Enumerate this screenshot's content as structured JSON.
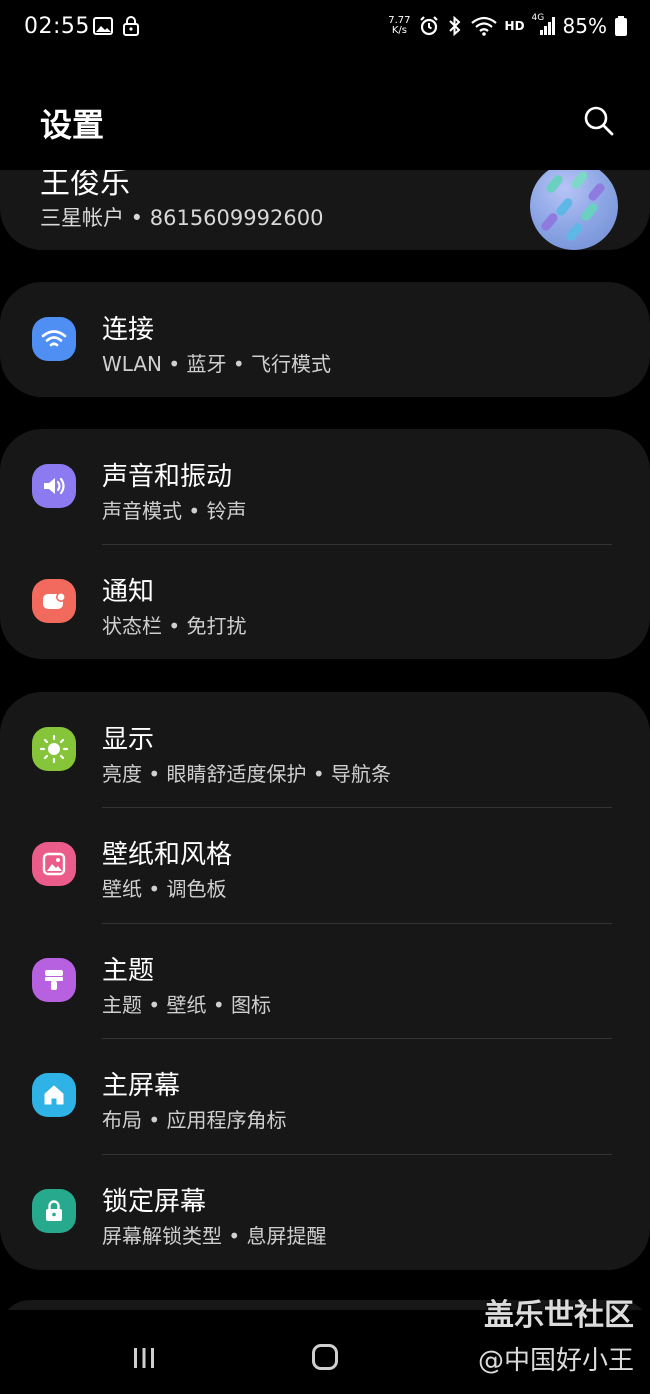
{
  "status_bar": {
    "time": "02:55",
    "net_speed_value": "7.77",
    "net_speed_unit": "K/s",
    "hd_label": "HD",
    "network_label": "4G",
    "battery_percent": "85%",
    "icons": [
      "gallery-icon",
      "lock-icon",
      "alarm-icon",
      "bluetooth-icon",
      "wifi-icon",
      "signal-icon",
      "battery-icon"
    ]
  },
  "header": {
    "title": "设置",
    "search_icon": "search-icon"
  },
  "account": {
    "name": "王俊乐",
    "subtitle": "三星帐户 • 8615609992600"
  },
  "groups": [
    {
      "items": [
        {
          "title": "连接",
          "subtitle": "WLAN • 蓝牙 • 飞行模式",
          "icon": "wifi-icon",
          "color": "#4f8ff3"
        }
      ]
    },
    {
      "items": [
        {
          "title": "声音和振动",
          "subtitle": "声音模式 • 铃声",
          "icon": "speaker-icon",
          "color": "#8c7af1"
        },
        {
          "title": "通知",
          "subtitle": "状态栏 • 免打扰",
          "icon": "notification-icon",
          "color": "#f26a5e"
        }
      ]
    },
    {
      "items": [
        {
          "title": "显示",
          "subtitle": "亮度 • 眼睛舒适度保护 • 导航条",
          "icon": "brightness-icon",
          "color": "#86c43a"
        },
        {
          "title": "壁纸和风格",
          "subtitle": "壁纸 • 调色板",
          "icon": "wallpaper-icon",
          "color": "#ec5c8a"
        },
        {
          "title": "主题",
          "subtitle": "主题 • 壁纸 • 图标",
          "icon": "theme-brush-icon",
          "color": "#b760e0"
        },
        {
          "title": "主屏幕",
          "subtitle": "布局 • 应用程序角标",
          "icon": "home-icon",
          "color": "#2fb3e6"
        },
        {
          "title": "锁定屏幕",
          "subtitle": "屏幕解锁类型 • 息屏提醒",
          "icon": "lock-icon",
          "color": "#27a98e"
        }
      ]
    }
  ],
  "navigation": {
    "recents_icon": "recents-icon",
    "home_icon": "home-button-icon"
  },
  "watermark": {
    "line1": "盖乐世社区",
    "line2": "@中国好小王"
  }
}
